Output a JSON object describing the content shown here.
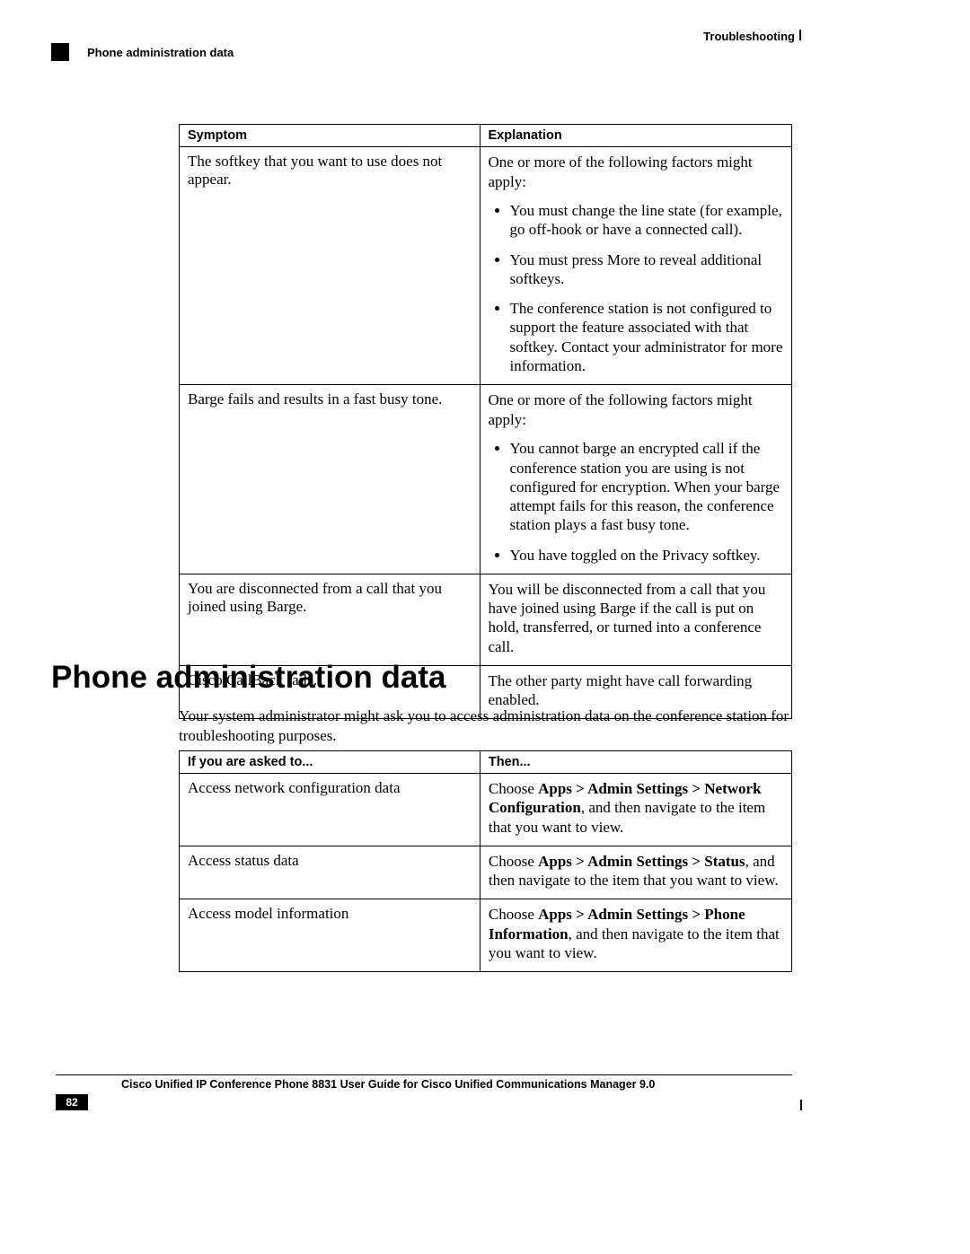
{
  "header": {
    "right": "Troubleshooting",
    "left": "Phone administration data"
  },
  "table1": {
    "headers": [
      "Symptom",
      "Explanation"
    ],
    "rows": [
      {
        "symptom": "The softkey that you want to use does not appear.",
        "intro": "One or more of the following factors might apply:",
        "bullets": [
          "You must change the line state (for example, go off-hook or have a connected call).",
          "You must press More to reveal additional softkeys.",
          "The conference station is not configured to support the feature associated with that softkey. Contact your administrator for more information."
        ]
      },
      {
        "symptom": "Barge fails and results in a fast busy tone.",
        "intro": "One or more of the following factors might apply:",
        "bullets": [
          "You cannot barge an encrypted call if the conference station you are using is not configured for encryption. When your barge attempt fails for this reason, the conference station plays a fast busy tone.",
          "You have toggled on the Privacy softkey."
        ]
      },
      {
        "symptom": "You are disconnected from a call that you joined using Barge.",
        "explanation_plain": "You will be disconnected from a call that you have joined using Barge if the call is put on hold, transferred, or turned into a conference call."
      },
      {
        "symptom": "Cisco CallBack fails.",
        "explanation_plain": "The other party might have call forwarding enabled."
      }
    ]
  },
  "h1": "Phone administration data",
  "intro": "Your system administrator might ask you to access administration data on the conference station for troubleshooting purposes.",
  "table2": {
    "headers": [
      "If you are asked to...",
      "Then..."
    ],
    "rows": [
      {
        "task": "Access network configuration data",
        "pre": "Choose ",
        "bold": "Apps > Admin Settings > Network Configuration",
        "post": ", and then navigate to the item that you want to view."
      },
      {
        "task": "Access status data",
        "pre": "Choose ",
        "bold": "Apps > Admin Settings > Status",
        "post": ", and then navigate to the item that you want to view."
      },
      {
        "task": "Access model information",
        "pre": "Choose ",
        "bold": "Apps > Admin Settings > Phone Information",
        "post": ", and then navigate to the item that you want to view."
      }
    ]
  },
  "footer": {
    "title": "Cisco Unified IP Conference Phone 8831 User Guide for Cisco Unified Communications Manager 9.0",
    "page": "82"
  }
}
